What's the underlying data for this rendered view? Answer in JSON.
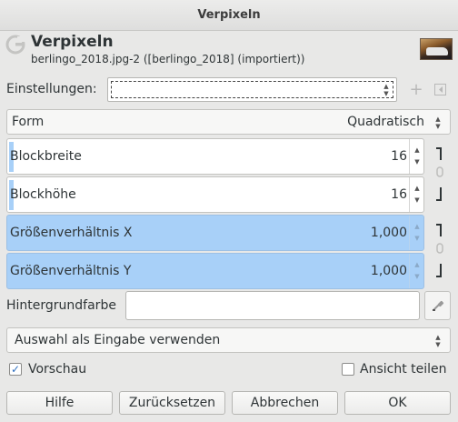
{
  "window": {
    "title": "Verpixeln"
  },
  "header": {
    "title": "Verpixeln",
    "subtitle": "berlingo_2018.jpg-2 ([berlingo_2018] (importiert))"
  },
  "presets": {
    "label": "Einstellungen:",
    "value": ""
  },
  "form": {
    "label": "Form",
    "value": "Quadratisch"
  },
  "fields": [
    {
      "name": "Blockbreite",
      "value": "16",
      "fill": 0.008
    },
    {
      "name": "Blockhöhe",
      "value": "16",
      "fill": 0.008
    },
    {
      "name": "Größenverhältnis X",
      "value": "1,000",
      "fill": 1.0
    },
    {
      "name": "Größenverhältnis Y",
      "value": "1,000",
      "fill": 1.0
    }
  ],
  "background": {
    "label": "Hintergrundfarbe",
    "color": "#ffffff"
  },
  "selection": {
    "label": "Auswahl als Eingabe verwenden"
  },
  "preview": {
    "label": "Vorschau",
    "checked": true
  },
  "split": {
    "label": "Ansicht teilen",
    "checked": false
  },
  "buttons": {
    "help": "Hilfe",
    "reset": "Zurücksetzen",
    "cancel": "Abbrechen",
    "ok": "OK"
  },
  "colors": {
    "accent": "#a8d0f8",
    "check": "#2f70c0",
    "window_bg": "#e8e8e7"
  }
}
